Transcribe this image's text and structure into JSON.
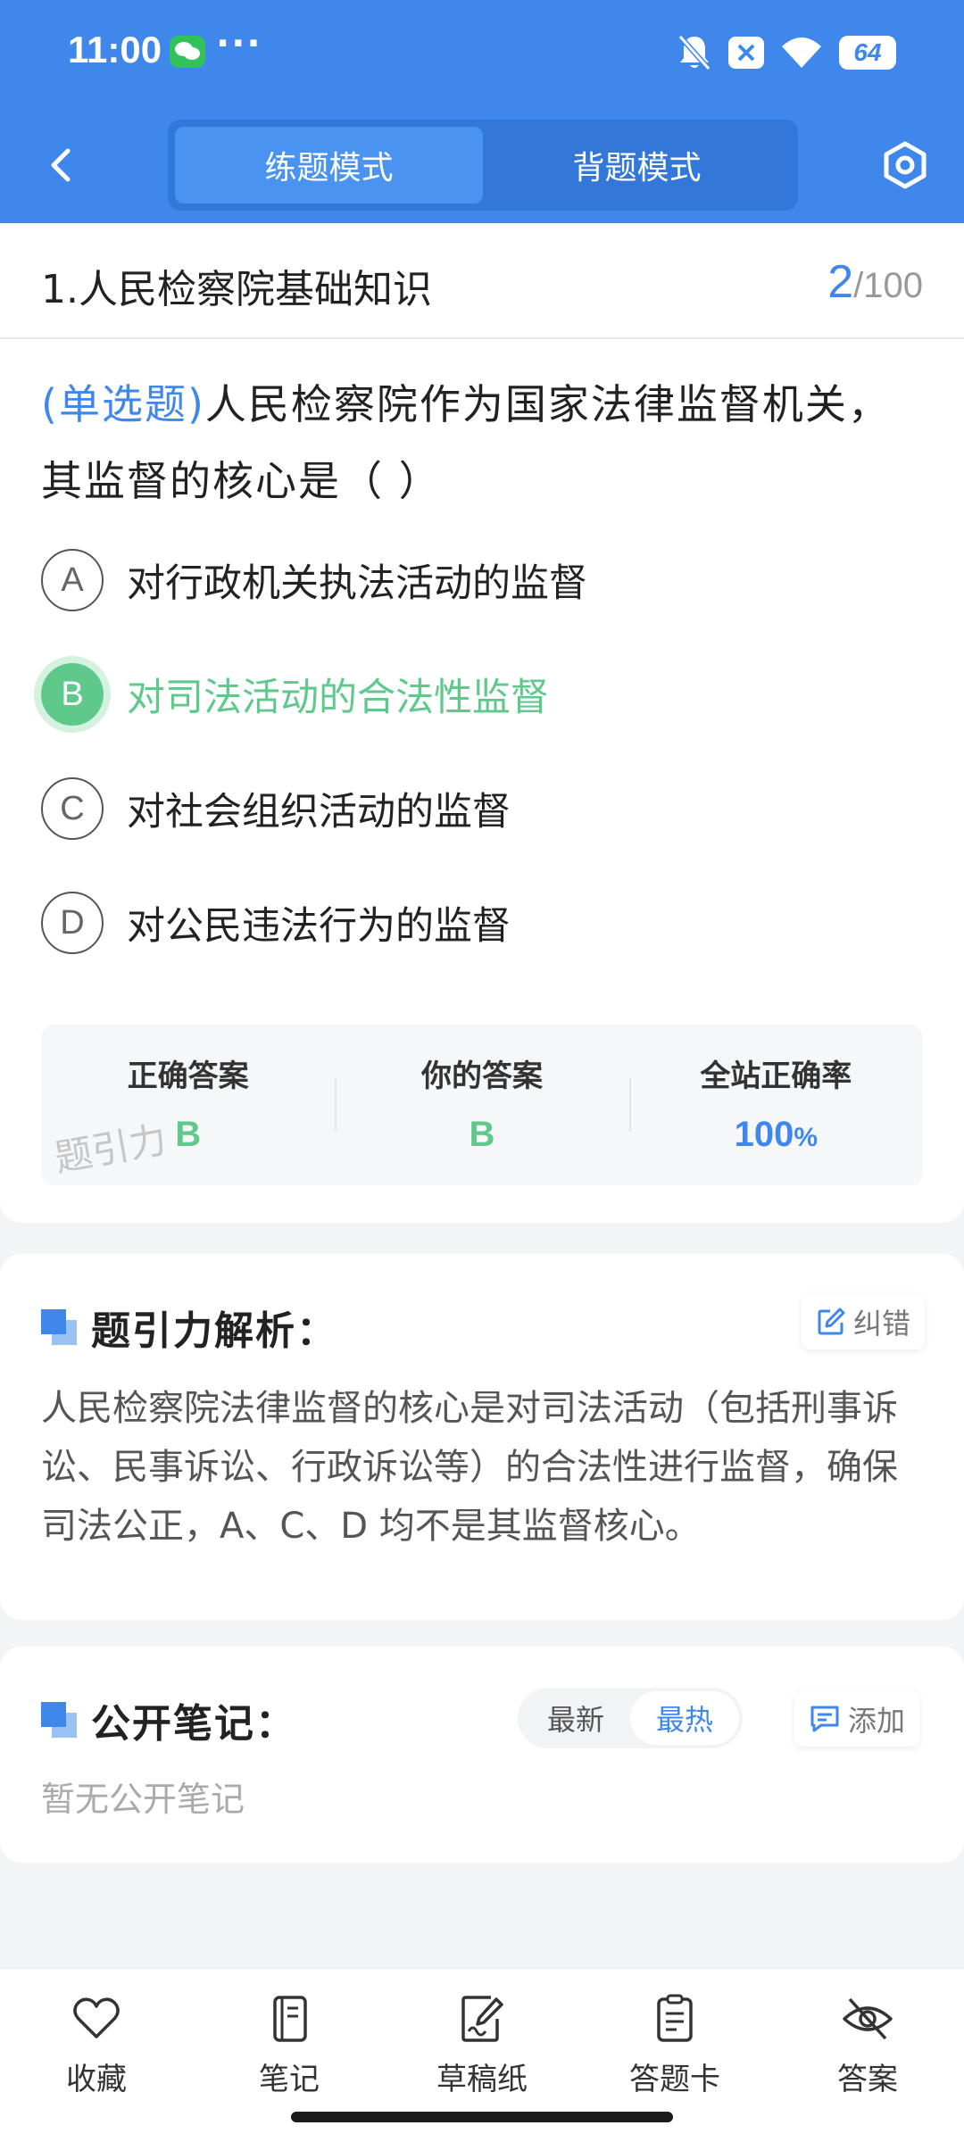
{
  "status_bar": {
    "time": "11:00",
    "app_icon": "wechat-icon",
    "more": "···",
    "battery": "64"
  },
  "nav": {
    "modes": [
      "练题模式",
      "背题模式"
    ],
    "active_mode": 0
  },
  "question": {
    "section": "1.人民检察院基础知识",
    "current": "2",
    "total": "/100",
    "type_label": "(单选题)",
    "text": "人民检察院作为国家法律监督机关，其监督的核心是（        ）",
    "options": [
      {
        "letter": "A",
        "text": "对行政机关执法活动的监督"
      },
      {
        "letter": "B",
        "text": "对司法活动的合法性监督"
      },
      {
        "letter": "C",
        "text": "对社会组织活动的监督"
      },
      {
        "letter": "D",
        "text": "对公民违法行为的监督"
      }
    ],
    "correct_index": 1
  },
  "stats": {
    "correct_label": "正确答案",
    "correct_value": "B",
    "yours_label": "你的答案",
    "yours_value": "B",
    "rate_label": "全站正确率",
    "rate_value": "100",
    "rate_unit": "%",
    "watermark": "题引力"
  },
  "analysis": {
    "title": "题引力解析：",
    "report_label": "纠错",
    "text": "人民检察院法律监督的核心是对司法活动（包括刑事诉讼、民事诉讼、行政诉讼等）的合法性进行监督，确保司法公正，A、C、D 均不是其监督核心。"
  },
  "notes": {
    "title": "公开笔记：",
    "sort_options": [
      "最新",
      "最热"
    ],
    "active_sort": 1,
    "add_label": "添加",
    "empty_text": "暂无公开笔记"
  },
  "toolbar": {
    "items": [
      {
        "label": "收藏",
        "icon": "heart-icon"
      },
      {
        "label": "笔记",
        "icon": "notebook-icon"
      },
      {
        "label": "草稿纸",
        "icon": "draft-icon"
      },
      {
        "label": "答题卡",
        "icon": "answer-card-icon"
      },
      {
        "label": "答案",
        "icon": "eye-off-icon"
      }
    ]
  },
  "colors": {
    "brand_blue": "#3f87ea",
    "correct_green": "#5fc98c"
  }
}
